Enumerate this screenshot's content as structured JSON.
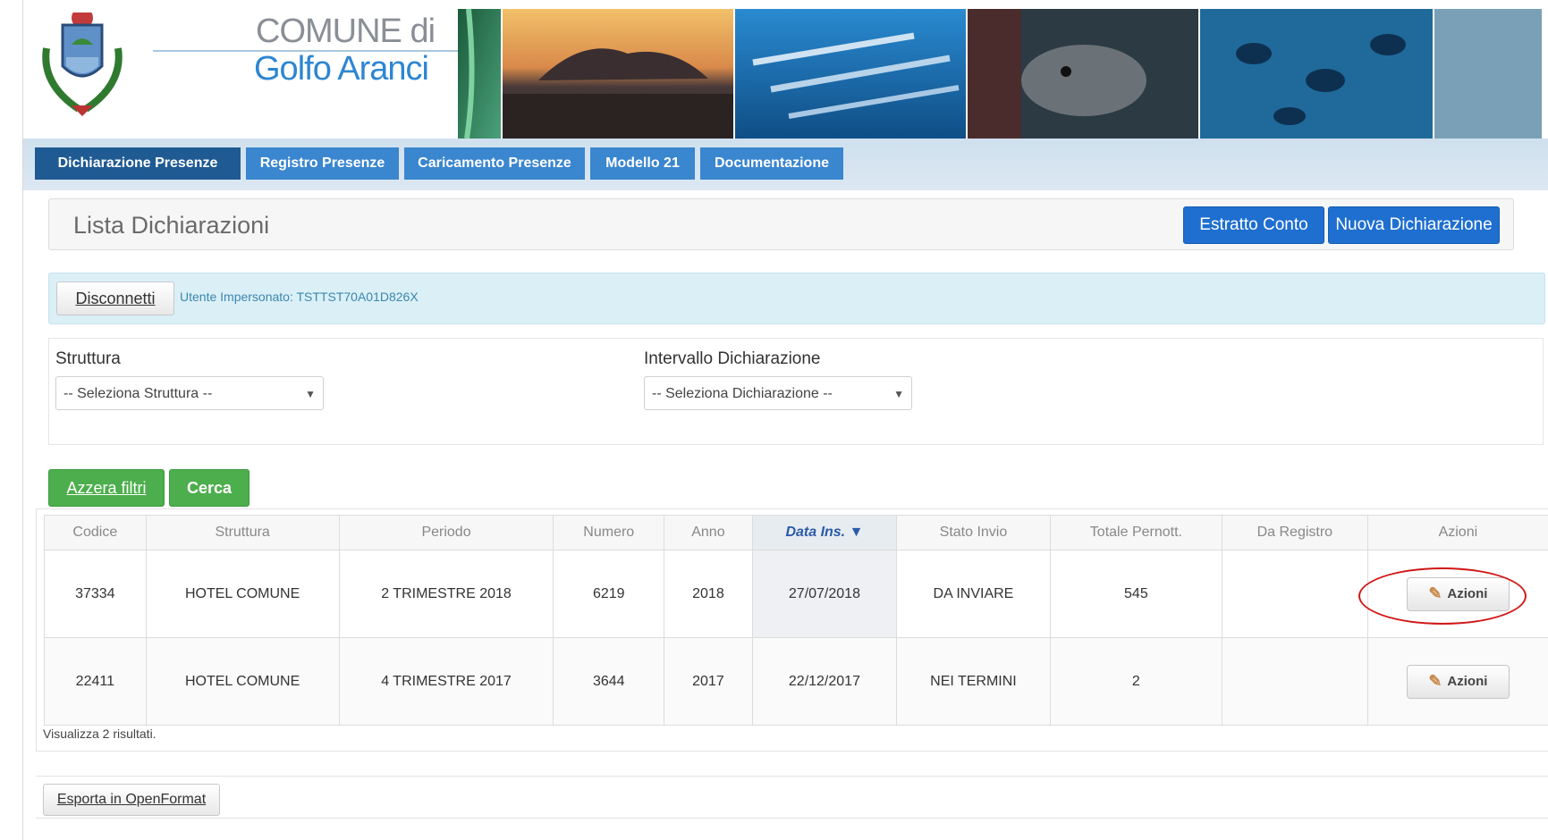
{
  "header": {
    "line1": "COMUNE di",
    "line2": "Golfo Aranci"
  },
  "nav": {
    "items": [
      {
        "label": "Dichiarazione Presenze",
        "active": true
      },
      {
        "label": "Registro Presenze",
        "active": false
      },
      {
        "label": "Caricamento Presenze",
        "active": false
      },
      {
        "label": "Modello 21",
        "active": false
      },
      {
        "label": "Documentazione",
        "active": false
      }
    ]
  },
  "page": {
    "title": "Lista Dichiarazioni",
    "btn_estratto": "Estratto Conto",
    "btn_nuova": "Nuova Dichiarazione"
  },
  "info": {
    "disconnect": "Disconnetti",
    "text": "Utente Impersonato: TSTTST70A01D826X"
  },
  "filters": {
    "struttura_label": "Struttura",
    "struttura_value": "-- Seleziona Struttura --",
    "intervallo_label": "Intervallo Dichiarazione",
    "intervallo_value": "-- Seleziona Dichiarazione --",
    "reset": "Azzera filtri",
    "search": "Cerca"
  },
  "table": {
    "columns": [
      "Codice",
      "Struttura",
      "Periodo",
      "Numero",
      "Anno",
      "Data Ins. ▼",
      "Stato Invio",
      "Totale Pernott.",
      "Da Registro",
      "Azioni"
    ],
    "rows": [
      [
        "37334",
        "HOTEL COMUNE",
        "2 TRIMESTRE 2018",
        "6219",
        "2018",
        "27/07/2018",
        "DA INVIARE",
        "545",
        "",
        "Azioni"
      ],
      [
        "22411",
        "HOTEL COMUNE",
        "4 TRIMESTRE 2017",
        "3644",
        "2017",
        "22/12/2017",
        "NEI TERMINI",
        "2",
        "",
        "Azioni"
      ]
    ]
  },
  "footer": {
    "results": "Visualizza 2 risultati.",
    "export": "Esporta in OpenFormat"
  },
  "colors": {
    "nav_active": "#1f5a93",
    "nav": "#3a86cf",
    "primary_button": "#1e6fd0",
    "green_button": "#4cae4c",
    "highlight_ellipse": "#d01818"
  }
}
